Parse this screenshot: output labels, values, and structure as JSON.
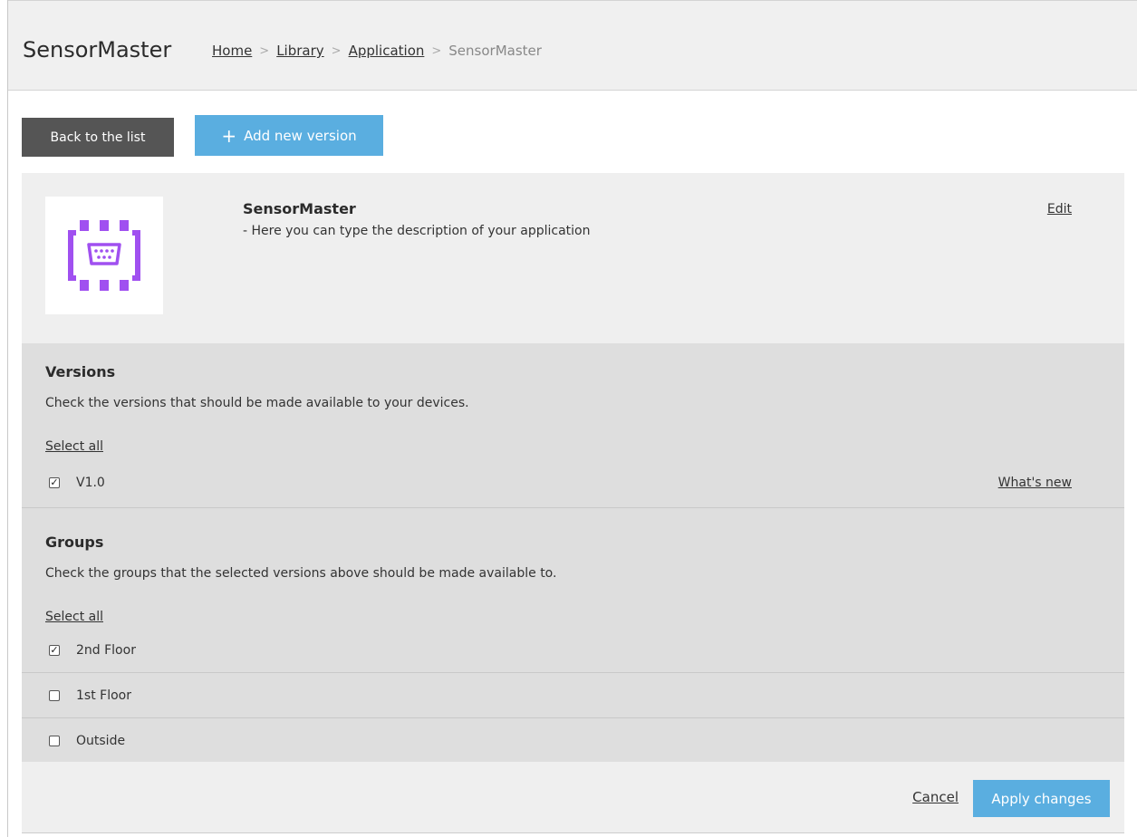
{
  "header": {
    "app_title": "SensorMaster",
    "breadcrumb": {
      "items": [
        "Home",
        "Library",
        "Application"
      ],
      "current": "SensorMaster",
      "separator": ">"
    }
  },
  "toolbar": {
    "back_label": "Back to the list",
    "add_icon": "+",
    "add_label": "Add new version"
  },
  "app": {
    "name": "SensorMaster",
    "description": "- Here you can type the description of your application",
    "edit_label": "Edit",
    "icon": "chip-connector-icon",
    "icon_color": "#a050f0"
  },
  "versions": {
    "title": "Versions",
    "description": "Check the versions that should be made available to your devices.",
    "select_all_label": "Select all",
    "items": [
      {
        "label": "V1.0",
        "checked": true,
        "link_label": "What's new"
      }
    ]
  },
  "groups": {
    "title": "Groups",
    "description": "Check the groups that the selected versions above should be made available to.",
    "select_all_label": "Select all",
    "items": [
      {
        "label": "2nd Floor",
        "checked": true
      },
      {
        "label": "1st Floor",
        "checked": false
      },
      {
        "label": "Outside",
        "checked": false
      }
    ]
  },
  "footer": {
    "cancel_label": "Cancel",
    "apply_label": "Apply changes"
  },
  "colors": {
    "accent": "#5aaee0",
    "dark_button": "#555555",
    "panel": "#efefef",
    "settings_panel": "#dedede"
  }
}
